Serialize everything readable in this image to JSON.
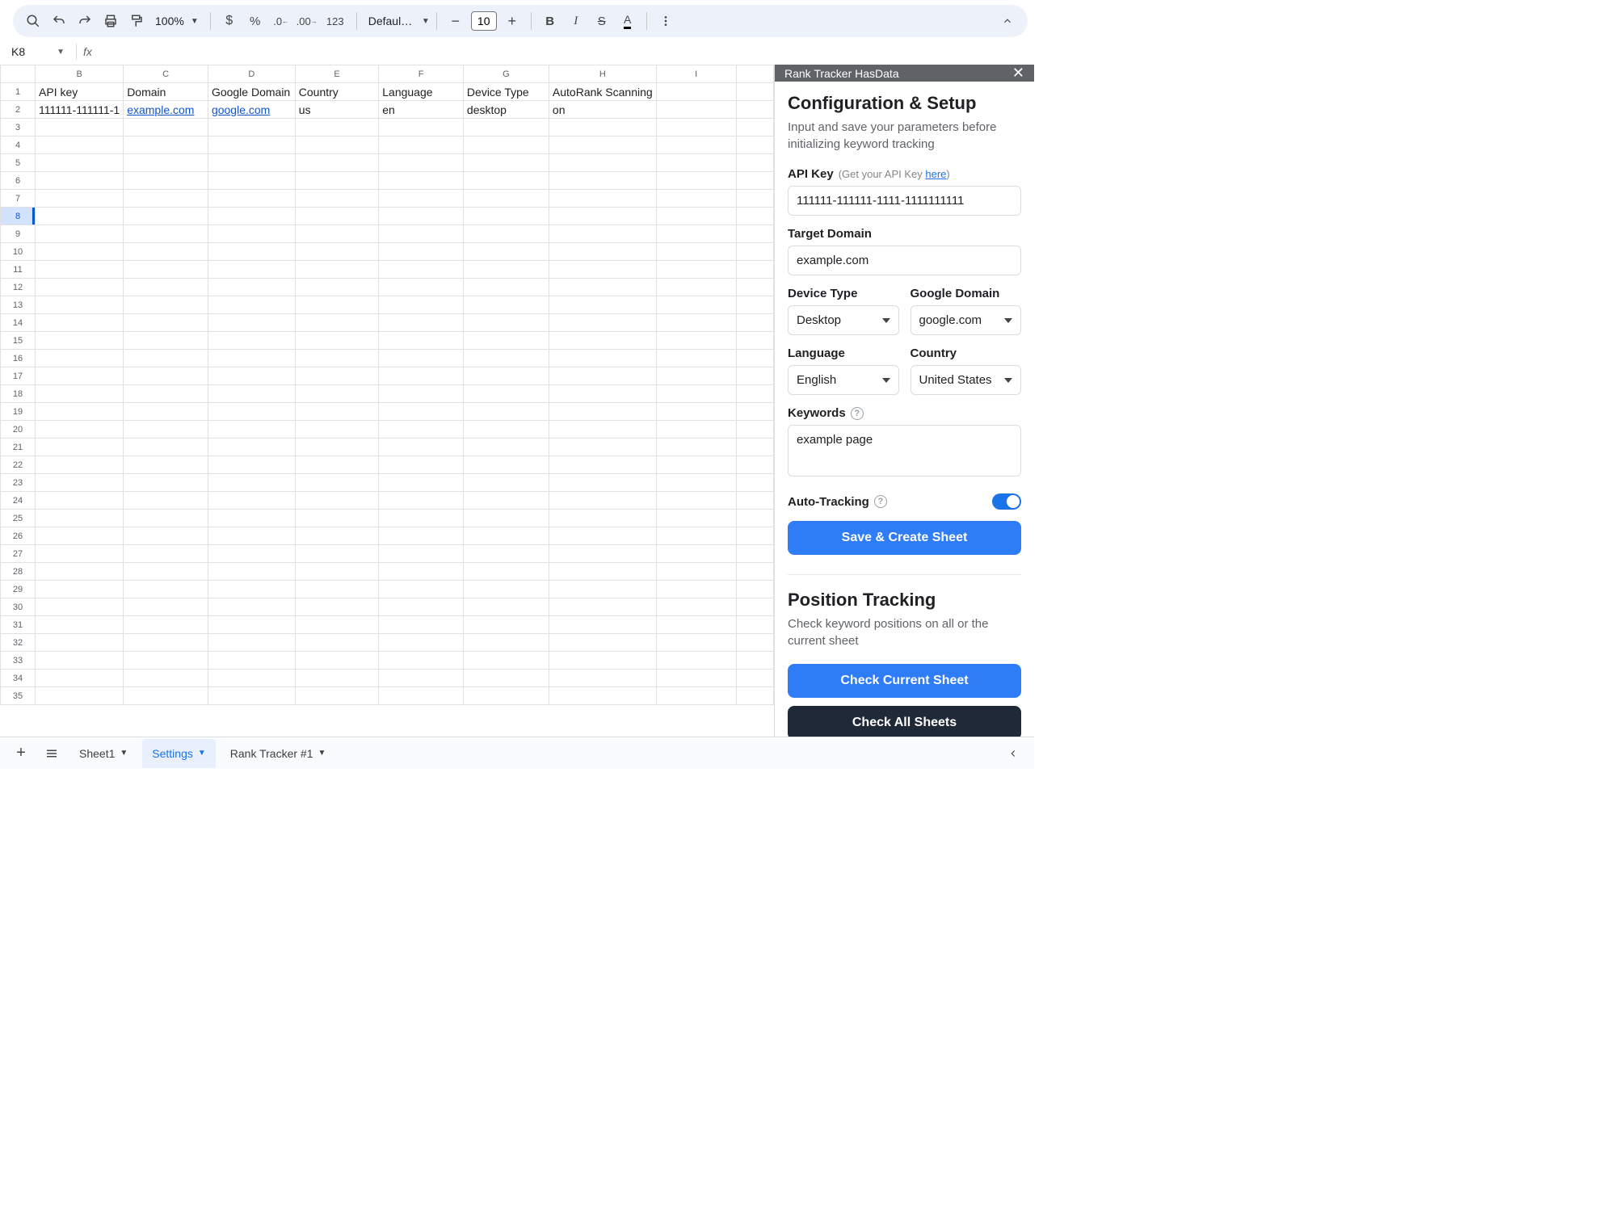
{
  "toolbar": {
    "zoom": "100%",
    "font": "Defaul…",
    "font_size": "10",
    "number_123": "123"
  },
  "namebox": {
    "cell": "K8"
  },
  "columns": [
    "B",
    "C",
    "D",
    "E",
    "F",
    "G",
    "H",
    "I"
  ],
  "row_numbers": [
    "1",
    "2",
    "3",
    "4",
    "5",
    "6",
    "7",
    "8",
    "9",
    "10",
    "11",
    "12",
    "13",
    "14",
    "15",
    "16",
    "17",
    "18",
    "19",
    "20",
    "21",
    "22",
    "23",
    "24",
    "25",
    "26",
    "27",
    "28",
    "29",
    "30",
    "31",
    "32",
    "33",
    "34",
    "35"
  ],
  "active_row": "8",
  "headers": {
    "B": "API key",
    "C": "Domain",
    "D": "Google Domain",
    "E": "Country",
    "F": "Language",
    "G": "Device Type",
    "H": "AutoRank Scanning"
  },
  "row2": {
    "B": "111111-111111-1",
    "C": "example.com",
    "D": "google.com",
    "E": "us",
    "F": "en",
    "G": "desktop",
    "H": "on"
  },
  "sidebar": {
    "title": "Rank Tracker HasData",
    "h1": "Configuration & Setup",
    "sub": "Input and save your parameters before initializing keyword tracking",
    "api_key_label": "API Key",
    "api_key_hint_prefix": "(Get your API Key ",
    "api_key_hint_link": "here",
    "api_key_hint_suffix": ")",
    "api_key_value": "111111-111111-1111-1111111111",
    "domain_label": "Target Domain",
    "domain_value": "example.com",
    "device_label": "Device Type",
    "device_value": "Desktop",
    "gdomain_label": "Google Domain",
    "gdomain_value": "google.com",
    "lang_label": "Language",
    "lang_value": "English",
    "country_label": "Country",
    "country_value": "United States",
    "keywords_label": "Keywords",
    "keywords_value": "example page",
    "autotrack_label": "Auto-Tracking",
    "save_btn": "Save & Create Sheet",
    "pos_h1": "Position Tracking",
    "pos_sub": "Check keyword positions on all or the current sheet",
    "check_current": "Check Current Sheet",
    "check_all": "Check All Sheets"
  },
  "tabs": {
    "sheet1": "Sheet1",
    "settings": "Settings",
    "rank1": "Rank Tracker #1"
  }
}
